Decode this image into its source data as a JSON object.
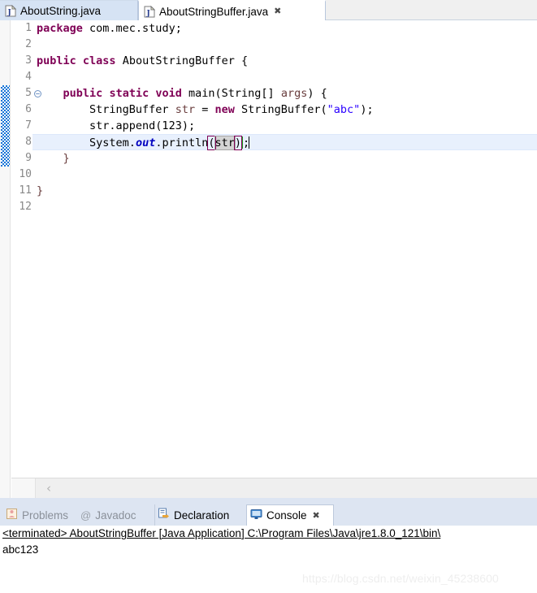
{
  "window": {
    "application": "Eclipse IDE",
    "watermark": "https://blog.csdn.net/weixin_45238600"
  },
  "editor_tabs": [
    {
      "label": "AboutString.java",
      "icon": "java-file-icon",
      "active": false,
      "closable": false
    },
    {
      "label": "AboutStringBuffer.java",
      "icon": "java-file-icon",
      "active": true,
      "closable": true,
      "close_glyph": "✖"
    }
  ],
  "editor": {
    "filename": "AboutStringBuffer.java",
    "current_line": 8,
    "change_bar_lines": [
      5,
      6,
      7,
      8,
      9
    ],
    "fold_marker_line": 5,
    "line_numbers": [
      1,
      2,
      3,
      4,
      5,
      6,
      7,
      8,
      9,
      10,
      11,
      12
    ],
    "lines": [
      {
        "n": 1,
        "text": "package com.mec.study;"
      },
      {
        "n": 2,
        "text": ""
      },
      {
        "n": 3,
        "text": "public class AboutStringBuffer {"
      },
      {
        "n": 4,
        "text": ""
      },
      {
        "n": 5,
        "text": "    public static void main(String[] args) {"
      },
      {
        "n": 6,
        "text": "        StringBuffer str = new StringBuffer(\"abc\");"
      },
      {
        "n": 7,
        "text": "        str.append(123);"
      },
      {
        "n": 8,
        "text": "        System.out.println(str);"
      },
      {
        "n": 9,
        "text": "    }"
      },
      {
        "n": 10,
        "text": ""
      },
      {
        "n": 11,
        "text": "}"
      },
      {
        "n": 12,
        "text": ""
      }
    ],
    "tokens": {
      "kw_package": "package",
      "pkg_name": " com.mec.study;",
      "kw_public": "public",
      "kw_class": "class",
      "class_name": "AboutStringBuffer {",
      "kw_static": "static",
      "kw_void": "void",
      "main_sig_a": "main(String[] ",
      "main_param": "args",
      "main_sig_b": ") {",
      "type_sb": "StringBuffer ",
      "var_str": "str",
      "assign": " = ",
      "kw_new": "new",
      "ctor": " StringBuffer(",
      "string_literal": "\"abc\"",
      "ctor_end": ");",
      "append_call": "str.append(123);",
      "sys": "System.",
      "out_field": "out",
      "println": ".println",
      "paren_open": "(",
      "arg_str": "str",
      "paren_close": ")",
      "semicolon": ";",
      "brace_close": "}"
    },
    "scrollbar": {
      "left_arrow": "‹"
    }
  },
  "view_tabs": [
    {
      "label": "Problems",
      "icon": "problems-icon",
      "active": false,
      "dim": true
    },
    {
      "label": "Javadoc",
      "icon": "javadoc-at-icon",
      "active": false,
      "dim": true
    },
    {
      "label": "Declaration",
      "icon": "declaration-icon",
      "active": false,
      "dim": false
    },
    {
      "label": "Console",
      "icon": "console-icon",
      "active": true,
      "dim": false,
      "closable": true,
      "close_glyph": "✖"
    }
  ],
  "console": {
    "header": "<terminated> AboutStringBuffer [Java Application] C:\\Program Files\\Java\\jre1.8.0_121\\bin\\",
    "output": "abc123"
  },
  "colors": {
    "keyword": "#7f0055",
    "string": "#2a00ff",
    "field": "#0000c0",
    "parameter": "#6a3e3e",
    "current_line_bg": "#e8f0fd",
    "tab_inactive_bg": "#d6e3f4",
    "view_tab_bg": "#dde5f2",
    "change_bar": "#1473d6"
  }
}
